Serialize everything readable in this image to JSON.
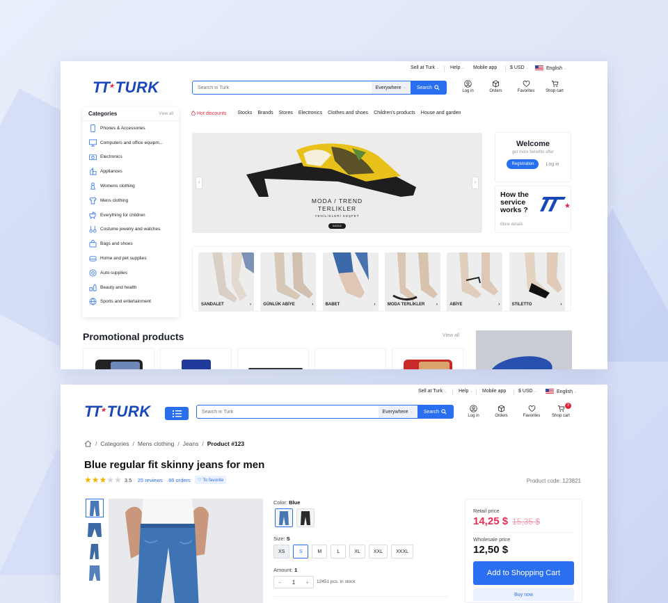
{
  "colors": {
    "accent": "#2a6ff0",
    "brand": "#1747b8",
    "logo_star": "#e0263f",
    "hot": "#e0263f",
    "price": "#e82b55"
  },
  "topbar": {
    "sell": "Sell at Turk",
    "help": "Help",
    "mobile": "Mobile app",
    "currency": "$ USD",
    "language": "English"
  },
  "logo": {
    "text": "TURK"
  },
  "search": {
    "placeholder": "Search in Turk",
    "scope": "Everywhere",
    "button": "Search"
  },
  "actions": {
    "login": "Log in",
    "orders": "Orders",
    "favorites": "Favorites",
    "cart": "Shop cart",
    "cart_badge": "3"
  },
  "categories": {
    "title": "Categories",
    "view_all": "View all",
    "items": [
      {
        "label": "Phones & Accessories",
        "icon": "phone-icon"
      },
      {
        "label": "Computers and office equipm...",
        "icon": "computer-icon"
      },
      {
        "label": "Electronics",
        "icon": "camera-icon"
      },
      {
        "label": "Appliances",
        "icon": "appliance-icon"
      },
      {
        "label": "Womens clothing",
        "icon": "dress-icon"
      },
      {
        "label": "Mens clothing",
        "icon": "shirt-icon"
      },
      {
        "label": "Everything for children",
        "icon": "stroller-icon"
      },
      {
        "label": "Costume jewelry and watches",
        "icon": "jewelry-icon"
      },
      {
        "label": "Bags and shoes",
        "icon": "bag-icon"
      },
      {
        "label": "Home and pet supplies",
        "icon": "home-icon"
      },
      {
        "label": "Auto supplies",
        "icon": "wheel-icon"
      },
      {
        "label": "Beauty and health",
        "icon": "beauty-icon"
      },
      {
        "label": "Sports and entertainment",
        "icon": "ball-icon"
      }
    ]
  },
  "nav": {
    "hot": "Hot discounts",
    "items": [
      "Stocks",
      "Brands",
      "Stores",
      "Electronics",
      "Clothes and shoes",
      "Children's products",
      "House and garden"
    ]
  },
  "banner": {
    "line1": "MODA / TREND",
    "line2": "TERLİKLER",
    "line3": "YENİLİKLERİ KEŞFET",
    "button": "İNCELE"
  },
  "welcome": {
    "title": "Welcome",
    "subtitle": "get more benefits after",
    "register": "Registration",
    "login": "Log in"
  },
  "how": {
    "title": "How the service works ?",
    "more": "More details"
  },
  "shoe_cards": [
    "SANDALET",
    "GÜNLÜK ABİYE",
    "BABET",
    "MODA TERLİKLER",
    "ABİYE",
    "STILETTO"
  ],
  "promo": {
    "title": "Promotional products",
    "view_all": "View all"
  },
  "product": {
    "breadcrumb": [
      "Categories",
      "Mens clothing",
      "Jeans",
      "Product #123"
    ],
    "title": "Blue regular fit skinny jeans for men",
    "rating": 3.5,
    "rating_text": "3.5",
    "reviews": "25 reviews",
    "orders": "86 orders",
    "favorite": "To favorite",
    "code": "Product code: 123821",
    "color_label": "Color:",
    "color": "Blue",
    "size_label": "Size:",
    "size": "S",
    "sizes": [
      "XS",
      "S",
      "M",
      "L",
      "XL",
      "XXL",
      "XXXL"
    ],
    "amount_label": "Amount:",
    "amount": "1",
    "stock": "12451 pcs. in stock",
    "retail_label": "Retail price",
    "retail_price": "14,25 $",
    "old_price": "15,35 $",
    "wholesale_label": "Wholesale price",
    "wholesale_price": "12,50 $",
    "add_to_cart": "Add to Shopping Cart",
    "buy_now": "Buy now"
  }
}
